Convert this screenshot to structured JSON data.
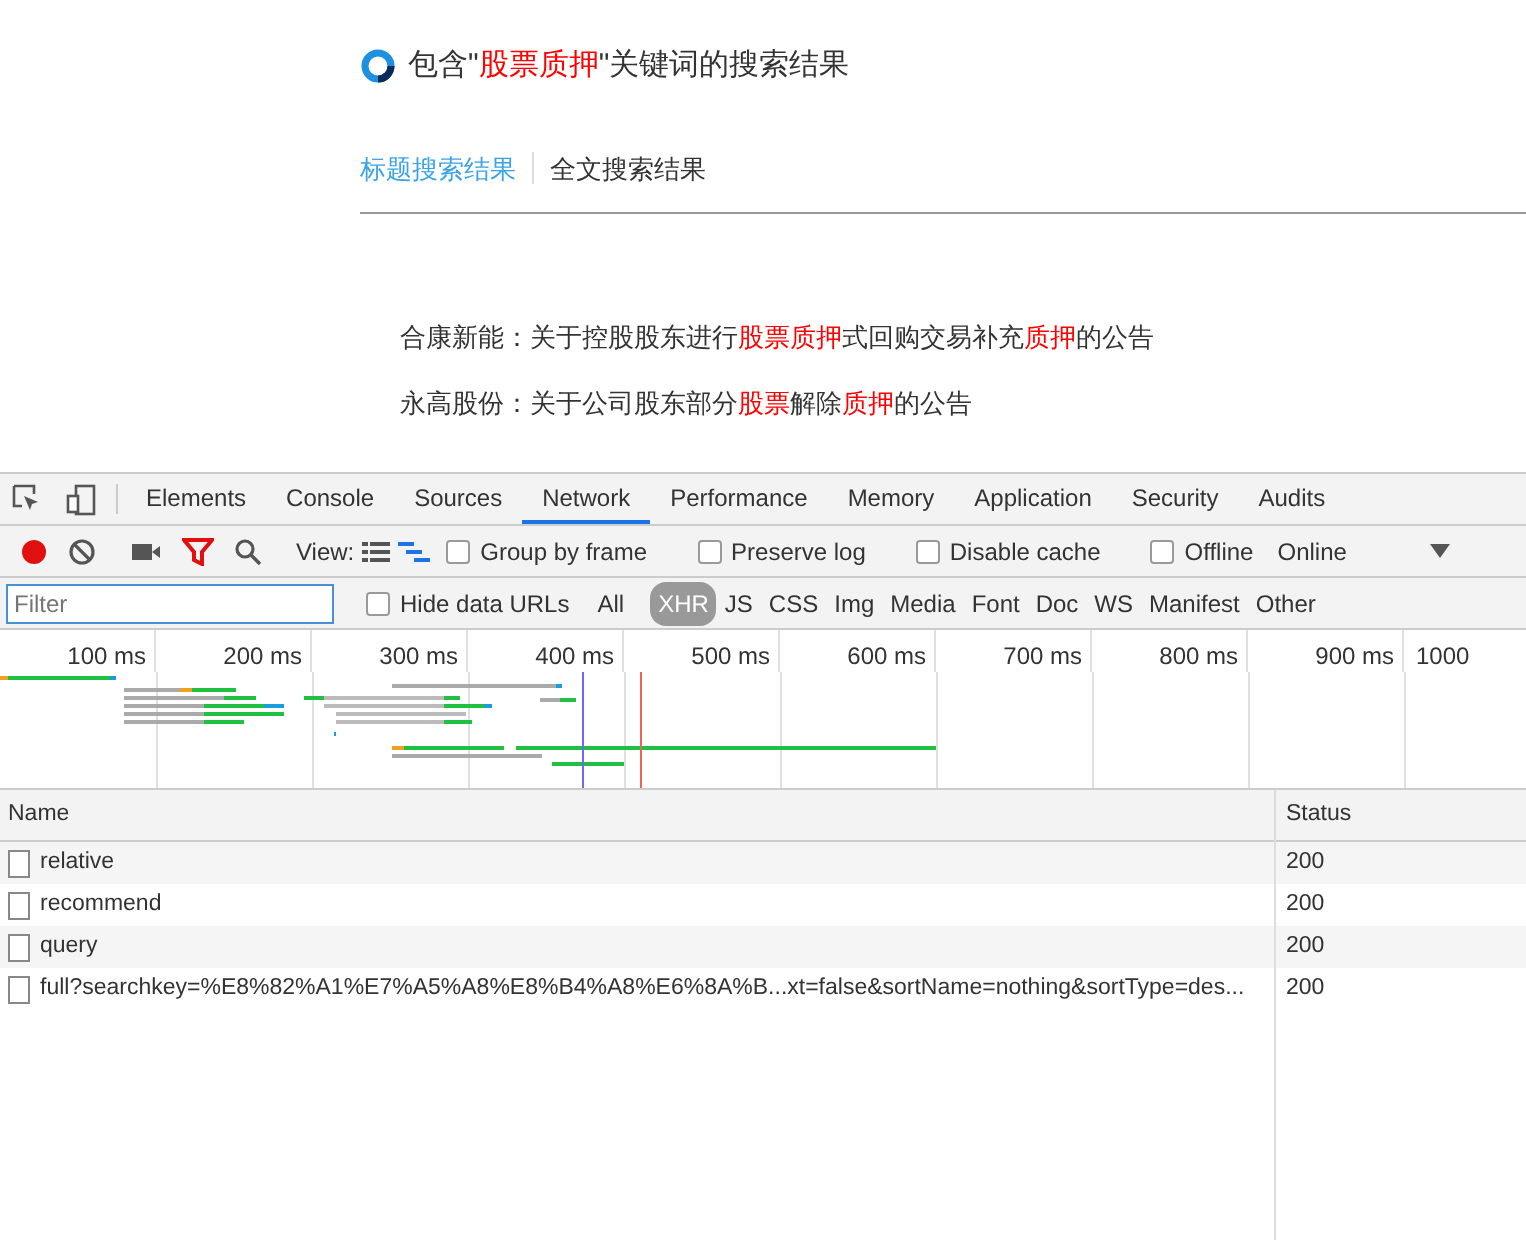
{
  "page": {
    "heading": [
      {
        "text": "包含\"",
        "highlight": false
      },
      {
        "text": "股票质押",
        "highlight": true
      },
      {
        "text": "\"关键词的搜索结果",
        "highlight": false
      }
    ],
    "tabs": [
      {
        "label": "标题搜索结果",
        "selected": true
      },
      {
        "label": "全文搜索结果",
        "selected": false
      }
    ],
    "results": [
      [
        {
          "text": "合康新能：关于控股股东进行",
          "highlight": false
        },
        {
          "text": "股票质押",
          "highlight": true
        },
        {
          "text": "式回购交易补充",
          "highlight": false
        },
        {
          "text": "质押",
          "highlight": true
        },
        {
          "text": "的公告",
          "highlight": false
        }
      ],
      [
        {
          "text": "永高股份：关于公司股东部分",
          "highlight": false
        },
        {
          "text": "股票",
          "highlight": true
        },
        {
          "text": "解除",
          "highlight": false
        },
        {
          "text": "质押",
          "highlight": true
        },
        {
          "text": "的公告",
          "highlight": false
        }
      ]
    ]
  },
  "devtools": {
    "tabs": [
      {
        "label": "Elements",
        "selected": false
      },
      {
        "label": "Console",
        "selected": false
      },
      {
        "label": "Sources",
        "selected": false
      },
      {
        "label": "Network",
        "selected": true
      },
      {
        "label": "Performance",
        "selected": false
      },
      {
        "label": "Memory",
        "selected": false
      },
      {
        "label": "Application",
        "selected": false
      },
      {
        "label": "Security",
        "selected": false
      },
      {
        "label": "Audits",
        "selected": false
      }
    ],
    "recording": true,
    "filter_active": true,
    "view_label": "View:",
    "options": [
      {
        "label": "Group by frame",
        "checked": false
      },
      {
        "label": "Preserve log",
        "checked": false
      },
      {
        "label": "Disable cache",
        "checked": false
      },
      {
        "label": "Offline",
        "checked": false
      }
    ],
    "throttle": "Online",
    "filter": {
      "placeholder": "Filter"
    },
    "hide_data_urls": {
      "label": "Hide data URLs",
      "checked": false
    },
    "types": [
      {
        "label": "All",
        "selected": false
      },
      {
        "label": "XHR",
        "selected": true
      },
      {
        "label": "JS",
        "selected": false
      },
      {
        "label": "CSS",
        "selected": false
      },
      {
        "label": "Img",
        "selected": false
      },
      {
        "label": "Media",
        "selected": false
      },
      {
        "label": "Font",
        "selected": false
      },
      {
        "label": "Doc",
        "selected": false
      },
      {
        "label": "WS",
        "selected": false
      },
      {
        "label": "Manifest",
        "selected": false
      },
      {
        "label": "Other",
        "selected": false
      }
    ],
    "timeline_ticks": [
      "100 ms",
      "200 ms",
      "300 ms",
      "400 ms",
      "500 ms",
      "600 ms",
      "700 ms",
      "800 ms",
      "900 ms",
      "1000"
    ],
    "table": {
      "columns": [
        "Name",
        "Status"
      ],
      "rows": [
        {
          "name": "relative",
          "status": "200"
        },
        {
          "name": "recommend",
          "status": "200"
        },
        {
          "name": "query",
          "status": "200"
        },
        {
          "name": "full?searchkey=%E8%82%A1%E7%A5%A8%E8%B4%A8%E6%8A%B...xt=false&sortName=nothing&sortType=des...",
          "status": "200"
        }
      ]
    }
  }
}
